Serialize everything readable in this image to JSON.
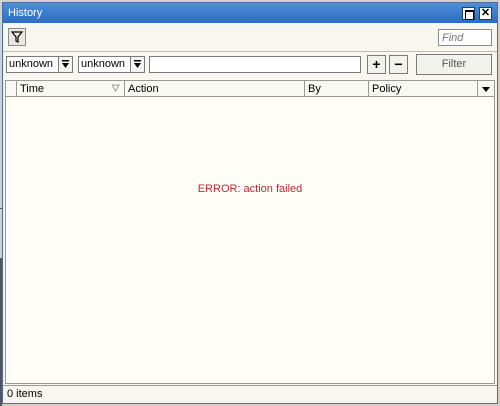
{
  "window": {
    "title": "History"
  },
  "toolbar": {
    "find_placeholder": "Find",
    "filter_icon": "funnel-icon"
  },
  "filter_bar": {
    "combo1_value": "unknown",
    "combo2_value": "unknown",
    "text_value": "",
    "add_label": "+",
    "remove_label": "−",
    "filter_label": "Filter"
  },
  "table": {
    "columns": [
      "Time",
      "Action",
      "By",
      "Policy"
    ],
    "message": "ERROR: action failed"
  },
  "status": {
    "items_count": "0 items"
  },
  "colors": {
    "titlebar": "#2b6cc4",
    "error": "#c0263a"
  }
}
